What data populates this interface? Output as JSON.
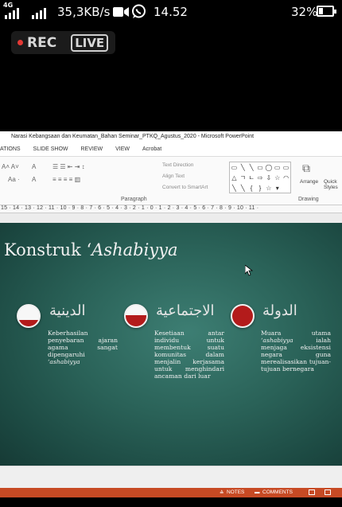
{
  "status_bar": {
    "network_tag": "4G",
    "speed": "35,3KB/s",
    "time": "14.52",
    "battery": "32%",
    "battery_level": 0.32,
    "icons": [
      "signal-icon",
      "signal-icon",
      "video-camera-icon",
      "whatsapp-icon",
      "battery-icon"
    ]
  },
  "recorder": {
    "rec_label": "REC",
    "live_label": "LIVE"
  },
  "powerpoint": {
    "window_title": "Narasi Kebangsaan dan Keumatan_Bahan Seminar_PTKQ_Agustus_2020 - Microsoft PowerPoint",
    "tabs": [
      "ATIONS",
      "SLIDE SHOW",
      "REVIEW",
      "VIEW",
      "Acrobat"
    ],
    "ribbon": {
      "text_direction": "Text Direction",
      "align_text": "Align Text",
      "convert_smartart": "Convert to SmartArt",
      "paragraph_label": "Paragraph",
      "drawing_label": "Drawing",
      "arrange_label": "Arrange",
      "quick_styles_label": "Quick Styles"
    },
    "ruler": "15 · 14 · 13 · 12 · 11 · 10 · 9 · 8 · 7 · 6 · 5 · 4 · 3 · 2 · 1 · 0 · 1 · 2 · 3 · 4 · 5 · 6 · 7 · 8 · 9 · 10 · 11 ·",
    "slide": {
      "title_plain": "Konstruk ‘",
      "title_italic": "Ashabiyya",
      "items": [
        {
          "arabic": "الدينية",
          "fill_level": 0.3,
          "text_before": "Keberhasilan penyebaran ajaran agama sangat dipengaruhi ",
          "text_italic": "‘ashabiyya",
          "text_after": ""
        },
        {
          "arabic": "الاجتماعية",
          "fill_level": 0.55,
          "text_before": "Kesetiaan antar individu untuk membentuk suatu komunitas dalam menjalin kerjasama untuk menghindari ancaman dari luar",
          "text_italic": "",
          "text_after": ""
        },
        {
          "arabic": "الدولة",
          "fill_level": 1.0,
          "text_before": "Muara utama ",
          "text_italic": "‘ashabiyya",
          "text_after": " ialah menjaga eksistensi negara guna merealisasikan tujuan-tujuan bernegara"
        }
      ]
    },
    "status": {
      "notes": "NOTES",
      "comments": "COMMENTS"
    }
  },
  "colors": {
    "slide_bg": "#2a6258",
    "accent_red": "#b31b1b",
    "ppt_status": "#c74a24"
  }
}
